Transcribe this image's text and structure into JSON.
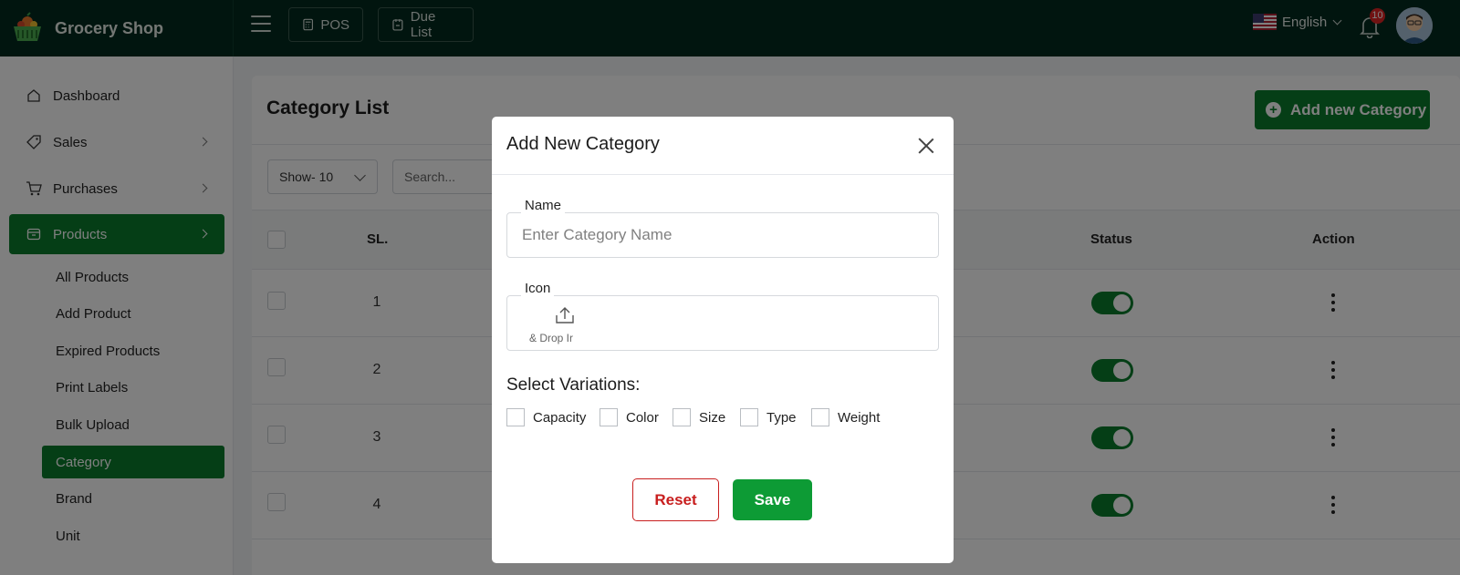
{
  "header": {
    "brand_name": "Grocery Shop",
    "pos_label": "POS",
    "due_list_label": "Due List",
    "language": "English",
    "notification_count": "10"
  },
  "sidebar": {
    "items": [
      {
        "label": "Dashboard",
        "icon": "dashboard-icon"
      },
      {
        "label": "Sales",
        "icon": "tag-icon"
      },
      {
        "label": "Purchases",
        "icon": "cart-icon"
      },
      {
        "label": "Products",
        "icon": "box-icon"
      }
    ],
    "product_subitems": [
      "All Products",
      "Add Product",
      "Expired Products",
      "Print Labels",
      "Bulk Upload",
      "Category",
      "Brand",
      "Unit"
    ]
  },
  "main": {
    "title": "Category List",
    "add_button": "Add new Category",
    "show_select": "Show- 10",
    "search_placeholder": "Search...",
    "columns": {
      "sl": "SL.",
      "status": "Status",
      "action": "Action"
    },
    "rows": [
      {
        "sl": "1",
        "status": true
      },
      {
        "sl": "2",
        "status": true
      },
      {
        "sl": "3",
        "status": true
      },
      {
        "sl": "4",
        "status": true
      }
    ]
  },
  "modal": {
    "title": "Add New Category",
    "name_label": "Name",
    "name_placeholder": "Enter Category Name",
    "icon_label": "Icon",
    "upload_text": "& Drop Ir",
    "variations_label": "Select Variations:",
    "variations": [
      "Capacity",
      "Color",
      "Size",
      "Type",
      "Weight"
    ],
    "reset_label": "Reset",
    "save_label": "Save"
  },
  "colors": {
    "topbar": "#022a1e",
    "accent": "#0a7d2c",
    "save": "#0d9b35",
    "reset": "#c81e1e"
  }
}
